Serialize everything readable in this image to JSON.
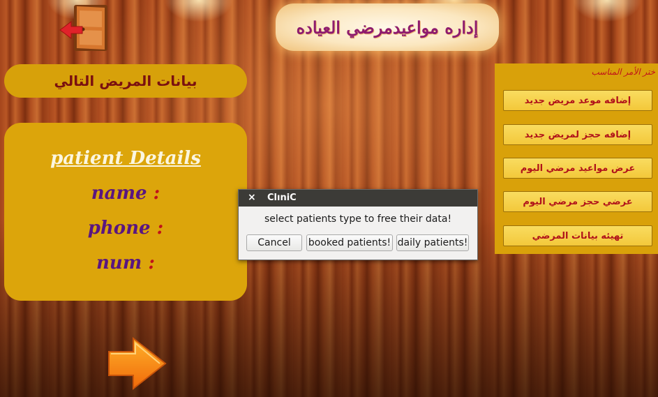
{
  "header": {
    "title": "إداره مواعيدمرضي العياده"
  },
  "exit": {
    "icon": "exit-door-icon"
  },
  "next_patient": {
    "header": "بيانات المريض التالي",
    "details_heading": "patient Details",
    "fields": {
      "name": "name",
      "phone": "phone",
      "num": "num"
    },
    "separator": ":"
  },
  "commands": {
    "prompt": "ختر الأمر المناسب",
    "buttons": [
      {
        "label": "إضافه موعد مريض جديد"
      },
      {
        "label": "إضافه حجز لمريض جديد"
      },
      {
        "label": "عرض مواعيد مرضي اليوم"
      },
      {
        "label": "عرضي حجز مرضي اليوم"
      },
      {
        "label": "تهيئه بيانات المرضي"
      }
    ]
  },
  "next_button": {
    "icon": "right-arrow-icon"
  },
  "dialog": {
    "close_symbol": "×",
    "title": "ClıniC",
    "message": "select patients type to free their data!",
    "buttons": {
      "cancel": "Cancel",
      "booked": "booked patients!",
      "daily": "daily patients!"
    }
  },
  "colors": {
    "title_text": "#8e1b6e",
    "panel_gold": "#dca50b",
    "button_text_red": "#b0121a",
    "detail_label_purple": "#5a1680",
    "colon_red": "#c0121a"
  }
}
